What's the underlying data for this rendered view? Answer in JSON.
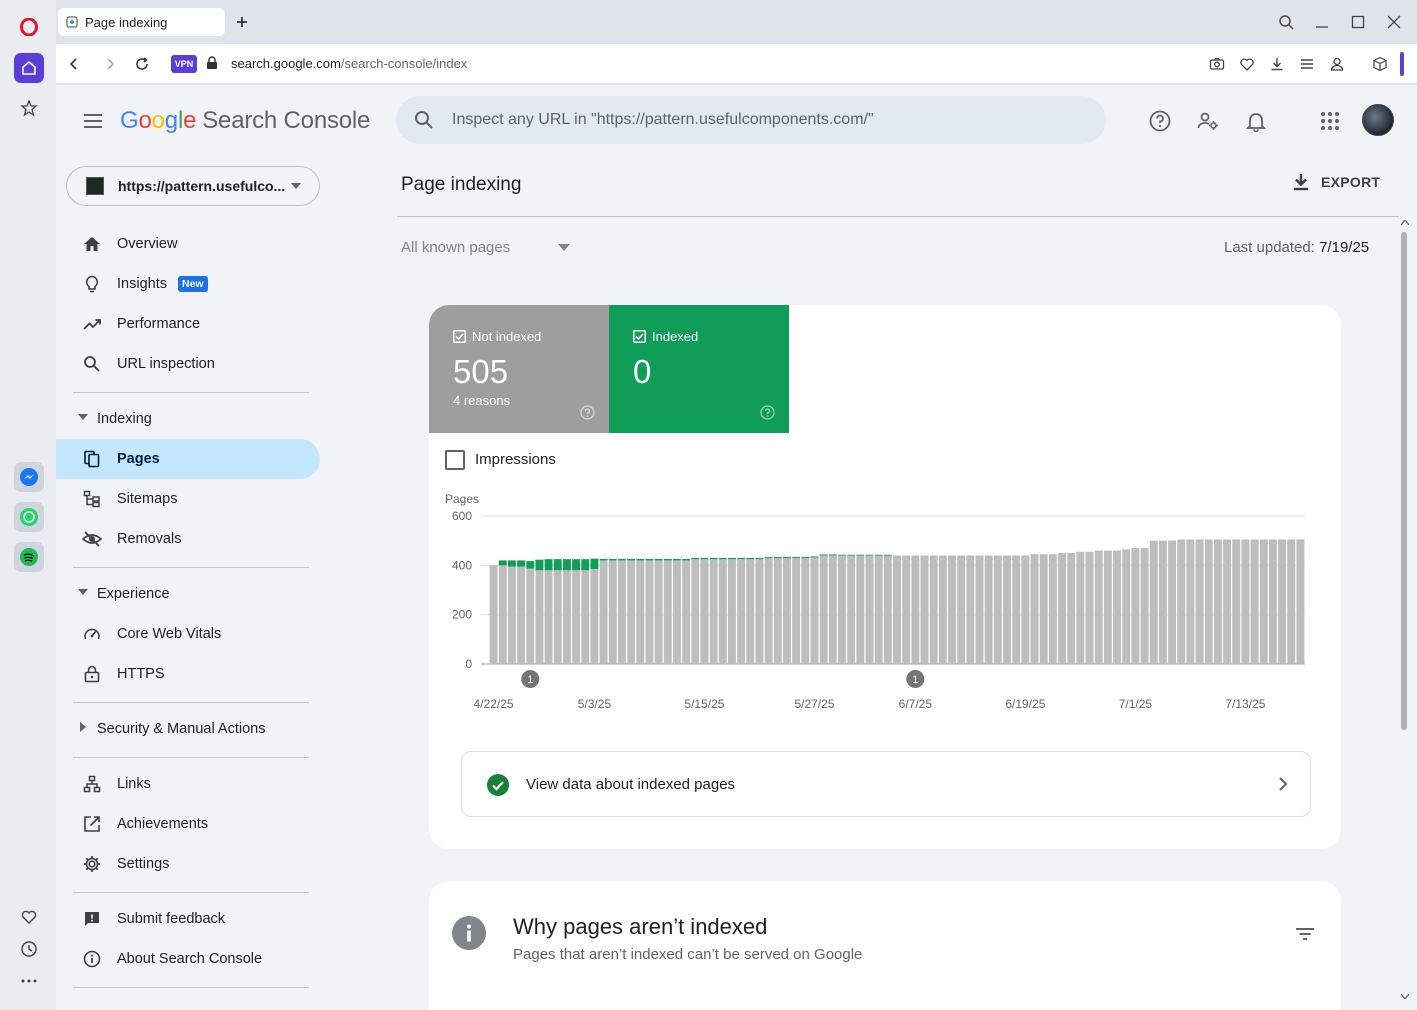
{
  "browser": {
    "tab_title": "Page indexing",
    "url_domain": "search.google.com",
    "url_path": "/search-console/index",
    "vpn_label": "VPN"
  },
  "header": {
    "logo_letters": [
      "G",
      "o",
      "o",
      "g",
      "l",
      "e"
    ],
    "product_name": "Search Console",
    "search_placeholder": "Inspect any URL in \"https://pattern.usefulcomponents.com/\""
  },
  "sidebar": {
    "property": "https://pattern.usefulco...",
    "items": [
      {
        "label": "Overview",
        "icon": "home-icon"
      },
      {
        "label": "Insights",
        "icon": "lightbulb-icon",
        "badge": "New"
      },
      {
        "label": "Performance",
        "icon": "trending-up-icon"
      },
      {
        "label": "URL inspection",
        "icon": "search-icon"
      }
    ],
    "indexing_section": {
      "label": "Indexing",
      "items": [
        {
          "label": "Pages",
          "icon": "pages-icon",
          "active": true
        },
        {
          "label": "Sitemaps",
          "icon": "sitemap-icon"
        },
        {
          "label": "Removals",
          "icon": "eye-off-icon"
        }
      ]
    },
    "experience_section": {
      "label": "Experience",
      "items": [
        {
          "label": "Core Web Vitals",
          "icon": "speedometer-icon"
        },
        {
          "label": "HTTPS",
          "icon": "lock-icon"
        }
      ]
    },
    "security_section": {
      "label": "Security & Manual Actions"
    },
    "more_items": [
      {
        "label": "Links",
        "icon": "links-icon"
      },
      {
        "label": "Achievements",
        "icon": "achievements-icon"
      },
      {
        "label": "Settings",
        "icon": "gear-icon"
      }
    ],
    "footer_items": [
      {
        "label": "Submit feedback",
        "icon": "feedback-icon"
      },
      {
        "label": "About Search Console",
        "icon": "info-icon"
      }
    ]
  },
  "main": {
    "title": "Page indexing",
    "export_label": "EXPORT",
    "filter_label": "All known pages",
    "last_updated_label": "Last updated:",
    "last_updated_value": "7/19/25",
    "tiles": {
      "not_indexed": {
        "label": "Not indexed",
        "value": "505",
        "sub": "4 reasons",
        "color": "#9e9e9e"
      },
      "indexed": {
        "label": "Indexed",
        "value": "0",
        "color": "#0f9d58"
      }
    },
    "impressions_label": "Impressions",
    "view_data_label": "View data about indexed pages",
    "why": {
      "title": "Why pages aren’t indexed",
      "subtitle": "Pages that aren’t indexed can’t be served on Google"
    }
  },
  "chart_data": {
    "type": "bar",
    "stacked": true,
    "ylabel": "Pages",
    "ylim": [
      0,
      600
    ],
    "yticks": [
      0,
      200,
      400,
      600
    ],
    "x_tick_labels": [
      "4/22/25",
      "5/3/25",
      "5/15/25",
      "5/27/25",
      "6/7/25",
      "6/19/25",
      "7/1/25",
      "7/13/25"
    ],
    "x_tick_indices": [
      0,
      11,
      23,
      35,
      46,
      58,
      70,
      82
    ],
    "annotations": [
      {
        "index": 4,
        "label": "1"
      },
      {
        "index": 46,
        "label": "1"
      }
    ],
    "series": [
      {
        "name": "Not indexed",
        "color": "#bdbdbd",
        "values": [
          400,
          400,
          395,
          395,
          387,
          380,
          380,
          380,
          380,
          380,
          380,
          385,
          420,
          420,
          420,
          420,
          420,
          420,
          420,
          420,
          420,
          420,
          425,
          425,
          425,
          425,
          425,
          425,
          425,
          425,
          430,
          430,
          430,
          430,
          430,
          432,
          440,
          440,
          440,
          440,
          440,
          440,
          440,
          440,
          440,
          440,
          440,
          440,
          440,
          440,
          440,
          440,
          440,
          440,
          440,
          440,
          440,
          440,
          440,
          445,
          445,
          445,
          450,
          450,
          455,
          455,
          460,
          460,
          460,
          465,
          470,
          470,
          500,
          500,
          500,
          505,
          505,
          505,
          505,
          505,
          505,
          505,
          505,
          505,
          505,
          505,
          505,
          505,
          505
        ]
      },
      {
        "name": "Indexed",
        "color": "#0f9d58",
        "values": [
          0,
          20,
          25,
          25,
          30,
          43,
          45,
          45,
          45,
          45,
          45,
          42,
          6,
          6,
          6,
          6,
          6,
          6,
          6,
          6,
          6,
          6,
          5,
          5,
          5,
          5,
          5,
          5,
          5,
          5,
          4,
          4,
          4,
          4,
          4,
          4,
          4,
          4,
          3,
          3,
          3,
          3,
          3,
          3,
          0,
          0,
          0,
          0,
          0,
          0,
          0,
          0,
          0,
          0,
          0,
          0,
          0,
          0,
          0,
          0,
          0,
          0,
          0,
          0,
          0,
          0,
          0,
          0,
          0,
          0,
          0,
          0,
          0,
          0,
          0,
          0,
          0,
          0,
          0,
          0,
          0,
          0,
          0,
          0,
          0,
          0,
          0,
          0,
          0,
          0
        ]
      }
    ]
  }
}
